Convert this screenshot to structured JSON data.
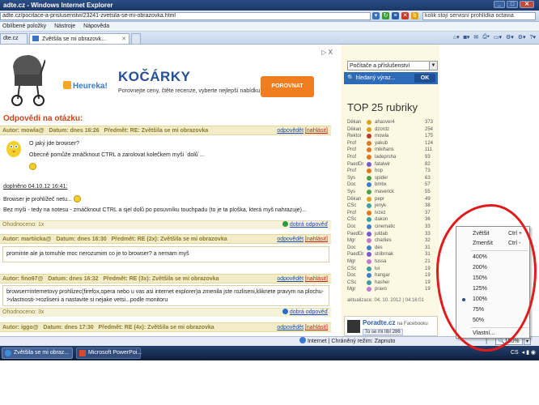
{
  "window": {
    "title": "adte.cz - Windows Internet Explorer"
  },
  "address": {
    "url": "adte.cz/pocitace-a-prislusenstvi/23241-zvetsila-se-mi-obrazovka.html",
    "search_text": "kolik stojí servisní prohlídka octavia"
  },
  "menu": {
    "items": [
      "Oblíbené položky",
      "Nástroje",
      "Nápověda"
    ]
  },
  "tabs": [
    {
      "label": "dte.cz"
    },
    {
      "label": "Zvětšila se mi obrazovk..."
    }
  ],
  "ad": {
    "close": "▷ X",
    "brand": "Heureka!",
    "headline": "KOČÁRKY",
    "sub": "Porovnejte ceny, čtěte recenze, vyberte nejlepší nabídku",
    "button": "POROVNAT NABÍDKY"
  },
  "answers_heading": "Odpovědi na otázku:",
  "posts": [
    {
      "author": "Autor: mowla@",
      "date": "Datum: dnes 16:26",
      "subject": "Předmět: RE: Zvětšila se mi obrazovka",
      "reply": "odpovědět",
      "report": "[nahlásit]",
      "lines": [
        "O jaký jde browser?",
        "Obecně pomůže zmáčknout CTRL a zarolovat kolečkem myši `dolů`..."
      ],
      "addendum_head": "doplněno 04.10.12 16:41:",
      "addendum": [
        "Browser je prohlížeč netu...",
        "Bez myši - tedy na notesu - zmáčknout CTRL a sjel dolů po posuvníku touchpadu (to je ta ploška, která myš nahrazuje)..."
      ],
      "rating": "Ohodnoceno: 1x",
      "good": "dobrá odpověď"
    },
    {
      "author": "Autor: martiicka@",
      "date": "Datum: dnes 16:30",
      "subject": "Předmět: RE (2x): Zvětšila se mi obrazovka",
      "reply": "odpovědět",
      "report": "[nahlásit]",
      "lines": [
        "prominte ale ja tomuhle moc nerozumim co je to browser? a nemam myš"
      ]
    },
    {
      "author": "Autor: fino97@",
      "date": "Datum: dnes 16:32",
      "subject": "Předmět: RE (3x): Zvětšila se mi obrazovka",
      "reply": "odpovědět",
      "report": "[nahlásit]",
      "lines": [
        "browser=internetovy prohlizec(firefox,opera nebo u vas asi internet explorer)a zmenila jste rozliseni,kliknete pravym na plochu-",
        ">vlastnosti->rozliseni a nastavite si nejake vetsi...podle monitoru"
      ],
      "rating": "Ohodnoceno: 3x",
      "good": "dobrá odpověď"
    },
    {
      "author": "Autor: iggo@",
      "date": "Datum: dnes 17:30",
      "subject": "Předmět: RE (4x): Zvětšila se mi obrazovka",
      "reply": "odpovědět",
      "report": "[nahlásit]"
    }
  ],
  "sidebar": {
    "category": "Počítače a příslušenství",
    "search_placeholder": "hledaný výraz...",
    "search_button": "OK",
    "top_title": "TOP 25 rubriky",
    "top": [
      {
        "role": "Děkan",
        "name": "ahasver4",
        "pts": "373",
        "color": "#d9a21b"
      },
      {
        "role": "Děkan",
        "name": "dzordz",
        "pts": "254",
        "color": "#d9a21b"
      },
      {
        "role": "Rektor",
        "name": "mowla",
        "pts": "175",
        "color": "#c0392b"
      },
      {
        "role": "Prof",
        "name": "yakub",
        "pts": "124",
        "color": "#e0781b"
      },
      {
        "role": "Prof",
        "name": "mikihans",
        "pts": "111",
        "color": "#e0781b"
      },
      {
        "role": "Prof",
        "name": "ladeprsha",
        "pts": "93",
        "color": "#e0781b"
      },
      {
        "role": "PaedDr",
        "name": "fatalwir",
        "pts": "82",
        "color": "#7a5ad0"
      },
      {
        "role": "Prof",
        "name": "hop",
        "pts": "73",
        "color": "#e0781b"
      },
      {
        "role": "Sys",
        "name": "spider",
        "pts": "63",
        "color": "#4aa14a"
      },
      {
        "role": "Doc",
        "name": "bmbx",
        "pts": "57",
        "color": "#3c7ec9"
      },
      {
        "role": "Sys",
        "name": "maverick",
        "pts": "55",
        "color": "#4aa14a"
      },
      {
        "role": "Děkan",
        "name": "pepr",
        "pts": "49",
        "color": "#d9a21b"
      },
      {
        "role": "CSc",
        "name": "jenyk",
        "pts": "38",
        "color": "#3aa0a0"
      },
      {
        "role": "Prof",
        "name": "ivzez",
        "pts": "37",
        "color": "#e0781b"
      },
      {
        "role": "CSc",
        "name": "dakon",
        "pts": "36",
        "color": "#3aa0a0"
      },
      {
        "role": "Doc",
        "name": "cinematic",
        "pts": "33",
        "color": "#3c7ec9"
      },
      {
        "role": "PaedDr",
        "name": "juldab",
        "pts": "33",
        "color": "#7a5ad0"
      },
      {
        "role": "Mgr",
        "name": "charlies",
        "pts": "32",
        "color": "#c07ad0"
      },
      {
        "role": "Doc",
        "name": "des",
        "pts": "31",
        "color": "#3c7ec9"
      },
      {
        "role": "PaedDr",
        "name": "stribrnak",
        "pts": "31",
        "color": "#7a5ad0"
      },
      {
        "role": "Mgr",
        "name": "tussa",
        "pts": "21",
        "color": "#c07ad0"
      },
      {
        "role": "CSc",
        "name": "lui",
        "pts": "19",
        "color": "#3aa0a0"
      },
      {
        "role": "Doc",
        "name": "hangar",
        "pts": "19",
        "color": "#3c7ec9"
      },
      {
        "role": "CSc",
        "name": "hasher",
        "pts": "19",
        "color": "#3aa0a0"
      },
      {
        "role": "Mgr",
        "name": "pravo",
        "pts": "19",
        "color": "#c07ad0"
      }
    ],
    "updated": "aktualizace: 04. 10. 2012 | 04:16:01",
    "fb_name": "Poradte.cz",
    "fb_suffix": "na Facebooku",
    "fb_like": "To se mi líbí",
    "fb_count": "286"
  },
  "status": {
    "text": "Internet | Chráněný režim: Zapnuto",
    "zoom": "100%"
  },
  "zoom_menu": {
    "zoom_in": "Zvětšit",
    "zoom_in_sc": "Ctrl +",
    "zoom_out": "Zmenšit",
    "zoom_out_sc": "Ctrl -",
    "levels": [
      "400%",
      "200%",
      "150%",
      "125%",
      "100%",
      "75%",
      "50%"
    ],
    "selected": "100%",
    "custom": "Vlastní..."
  },
  "taskbar": {
    "items": [
      "Zvětšila se mi obraz...",
      "Microsoft PowerPoi..."
    ],
    "tray": "CS"
  },
  "colors": {
    "annotation": "#e11b1b",
    "header_bg": "#f3ecc8",
    "link": "#1a4cb8",
    "accent_orange": "#c4471b"
  }
}
